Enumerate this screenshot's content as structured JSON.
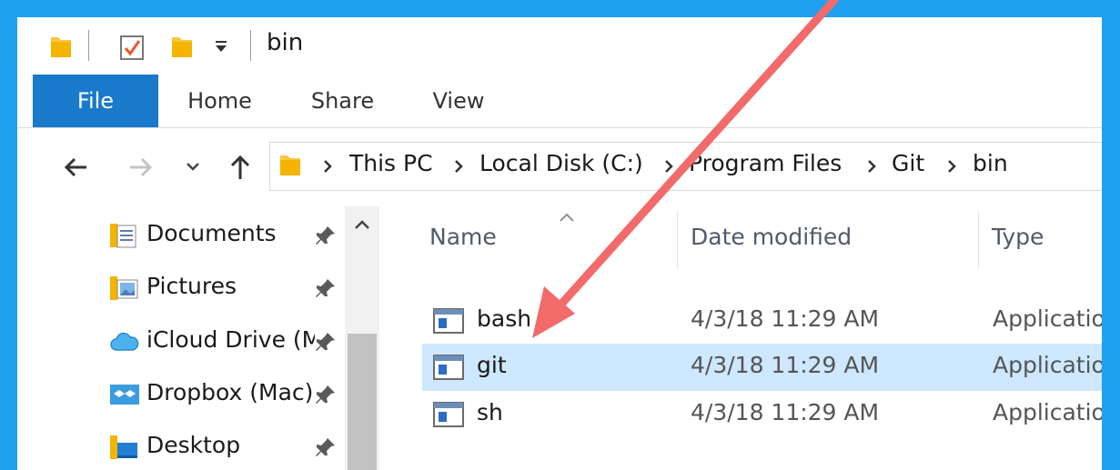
{
  "window": {
    "title": "bin"
  },
  "ribbon": {
    "tabs": [
      "File",
      "Home",
      "Share",
      "View"
    ]
  },
  "address": {
    "crumbs": [
      "This PC",
      "Local Disk (C:)",
      "Program Files",
      "Git",
      "bin"
    ]
  },
  "nav_pane": {
    "items": [
      {
        "label": "Documents",
        "icon": "documents-folder-icon",
        "pinned": true
      },
      {
        "label": "Pictures",
        "icon": "pictures-folder-icon",
        "pinned": true
      },
      {
        "label": "iCloud Drive (Mac)",
        "icon": "icloud-icon",
        "pinned": true
      },
      {
        "label": "Dropbox (Mac)",
        "icon": "dropbox-icon",
        "pinned": true
      },
      {
        "label": "Desktop",
        "icon": "desktop-folder-icon",
        "pinned": true
      }
    ]
  },
  "file_list": {
    "columns": [
      "Name",
      "Date modified",
      "Type"
    ],
    "rows": [
      {
        "name": "bash",
        "date": "4/3/18 11:29 AM",
        "type": "Application",
        "selected": false
      },
      {
        "name": "git",
        "date": "4/3/18 11:29 AM",
        "type": "Application",
        "selected": true
      },
      {
        "name": "sh",
        "date": "4/3/18 11:29 AM",
        "type": "Application",
        "selected": false
      }
    ]
  },
  "colors": {
    "background": "#1ea1f1",
    "file_tab": "#1979ca",
    "selection": "#cde8ff",
    "annotation_arrow": "#f26a6a",
    "folder": "#f8c73d"
  }
}
